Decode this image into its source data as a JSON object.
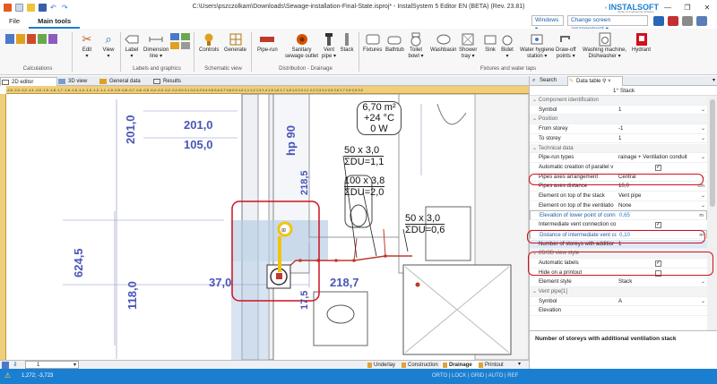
{
  "window": {
    "title": "C:\\Users\\pszczolkam\\Downloads\\Sewage-installation-Final-State.isproj* - InstalSystem 5 Editor EN (BETA) (Rev. 23.81)",
    "brand": "INSTALSOFT",
    "brand_sub": "design & engineering software"
  },
  "menu": {
    "file": "File",
    "main_tools": "Main tools",
    "windows": "Windows",
    "arrangement": "Change screen arrangement"
  },
  "ribbon": {
    "edit": "Edit",
    "view": "View",
    "label": "Label",
    "dimension": "Dimension",
    "dim_line": "line",
    "controls": "Controls",
    "generate": "Generate",
    "pipe_run": "Pipe-run",
    "sanitary": "Sanitary",
    "sewage_outlet": "sewage outlet",
    "vent": "Vent",
    "vent_pipe": "pipe",
    "stack": "Stack",
    "fixtures": "Fixtures",
    "bathtub": "Bathtub",
    "toilet": "Toilet",
    "toilet_bowl": "bowl",
    "washbasin": "Washbasin",
    "shower": "Shower",
    "shower_tray": "tray",
    "sink": "Sink",
    "bidet": "Bidet",
    "water_hygiene": "Water hygiene",
    "water_hygiene_station": "station",
    "draw_off": "Draw-off",
    "draw_off_points": "points",
    "washing": "Washing machine,",
    "dishwasher": "Dishwasher",
    "hydrant": "Hydrant",
    "groups": {
      "calculations": "Calculations",
      "labels": "Labels and graphics",
      "schematic": "Schematic view",
      "distribution": "Distribution - Drainage",
      "fixtures": "Fixtures and water taps"
    }
  },
  "doc_tabs": {
    "editor2d": "2D editor",
    "view3d": "3D view",
    "general": "General data",
    "results": "Results"
  },
  "ruler": "-2,5 -2,3 -2,2 -2,1 -2,0 -1,9 -1,8 -1,7 -1,6 -1,5 -1,4 -1,3 -1,2 -1,1 -1,0 -0,9 -0,8 -0,7 -0,6 -0,5 -0,4 -0,3 -0,2 -0,1 0,0 0,1 0,2 0,3 0,4 0,5 0,6 0,7 0,8 0,9 1,0 1,1 1,2 1,3 1,4 1,5 1,6 1,7 1,8 1,9 2,0 2,1 2,2 2,3 2,4 2,5 2,6 2,7 2,8 2,9 3,0",
  "drawing": {
    "dims": {
      "d1": "201,0",
      "d2": "105,0",
      "d3": "201,0",
      "d4": "hp 90",
      "d5": "218,5",
      "d6": "624,5",
      "d7": "118,0",
      "d8": "37,0",
      "d9": "17,5",
      "d10": "218,7"
    },
    "room": {
      "area": "6,70 m²",
      "temp": "+24 °C",
      "load": "0 W"
    },
    "pipes": {
      "p1": "50 x 3,0",
      "p1du": "ΣDU=1,1",
      "p2": "100 x 3,8",
      "p2du": "ΣDU=2,0",
      "p3": "50 x 3,0",
      "p3du": "ΣDU=0,6"
    }
  },
  "bottom_tabs": {
    "underlay": "Underlay",
    "construction": "Construction",
    "drainage": "Drainage",
    "printout": "Printout",
    "floor": "1"
  },
  "status": {
    "coords": "1,272; -3,723",
    "modes": "ORTO | LOCK | GRID | AUTO | REF"
  },
  "panel": {
    "tab_search": "Search",
    "tab_data": "Data table",
    "tab_pin": "⚲ ×",
    "caption": "1° Stack",
    "rows": [
      {
        "type": "sec",
        "name": "Component identification"
      },
      {
        "name": "Symbol",
        "value": "1",
        "ctrl": "chev"
      },
      {
        "type": "sec",
        "name": "Position"
      },
      {
        "name": "From storey",
        "value": "-1",
        "ctrl": "chev"
      },
      {
        "name": "To storey",
        "value": "1",
        "ctrl": "chev"
      },
      {
        "type": "sec",
        "name": "Technical data"
      },
      {
        "name": "Pipe-run types",
        "value": "rainage + Ventilation conduit",
        "ctrl": "chev"
      },
      {
        "name": "Automatic creation of parallel v",
        "value": "",
        "ctrl": "cb",
        "checked": "✓"
      },
      {
        "name": "Pipes axes arrangement",
        "value": "Central",
        "ctrl": "chev"
      },
      {
        "name": "Pipes axes distance",
        "value": "10,0",
        "ctrl": "unit",
        "unit": "cm"
      },
      {
        "name": "Element on top of the stack",
        "value": "Vent pipe",
        "ctrl": "chev"
      },
      {
        "name": "Element on top of the ventilatio",
        "value": "None",
        "ctrl": "chev"
      },
      {
        "name": "Elevation of lower point of conn",
        "value": "0,65",
        "ctrl": "unit",
        "unit": "m",
        "sel": true
      },
      {
        "name": "Intermediate vent connection co",
        "value": "",
        "ctrl": "cb",
        "checked": "✓"
      },
      {
        "name": "Distance of intermediate vent co",
        "value": "0,10",
        "ctrl": "unit",
        "unit": "m",
        "sel": true
      },
      {
        "name": "Number of storeys with additior",
        "value": "1",
        "ctrl": "none",
        "hl": true
      },
      {
        "type": "sec",
        "name": "2D/3D view style"
      },
      {
        "name": "Automatic labels",
        "value": "",
        "ctrl": "cb",
        "checked": "✓"
      },
      {
        "name": "Hide on a printout",
        "value": "",
        "ctrl": "cb",
        "checked": ""
      },
      {
        "name": "Element style",
        "value": "Stack",
        "ctrl": "chev"
      },
      {
        "type": "sec",
        "name": "Vent pipe[1]"
      },
      {
        "name": "Symbol",
        "value": "A",
        "ctrl": "chev"
      },
      {
        "name": "Elevation",
        "value": "",
        "ctrl": "none"
      }
    ],
    "description": "Number of storeys with additional ventilation stack"
  }
}
